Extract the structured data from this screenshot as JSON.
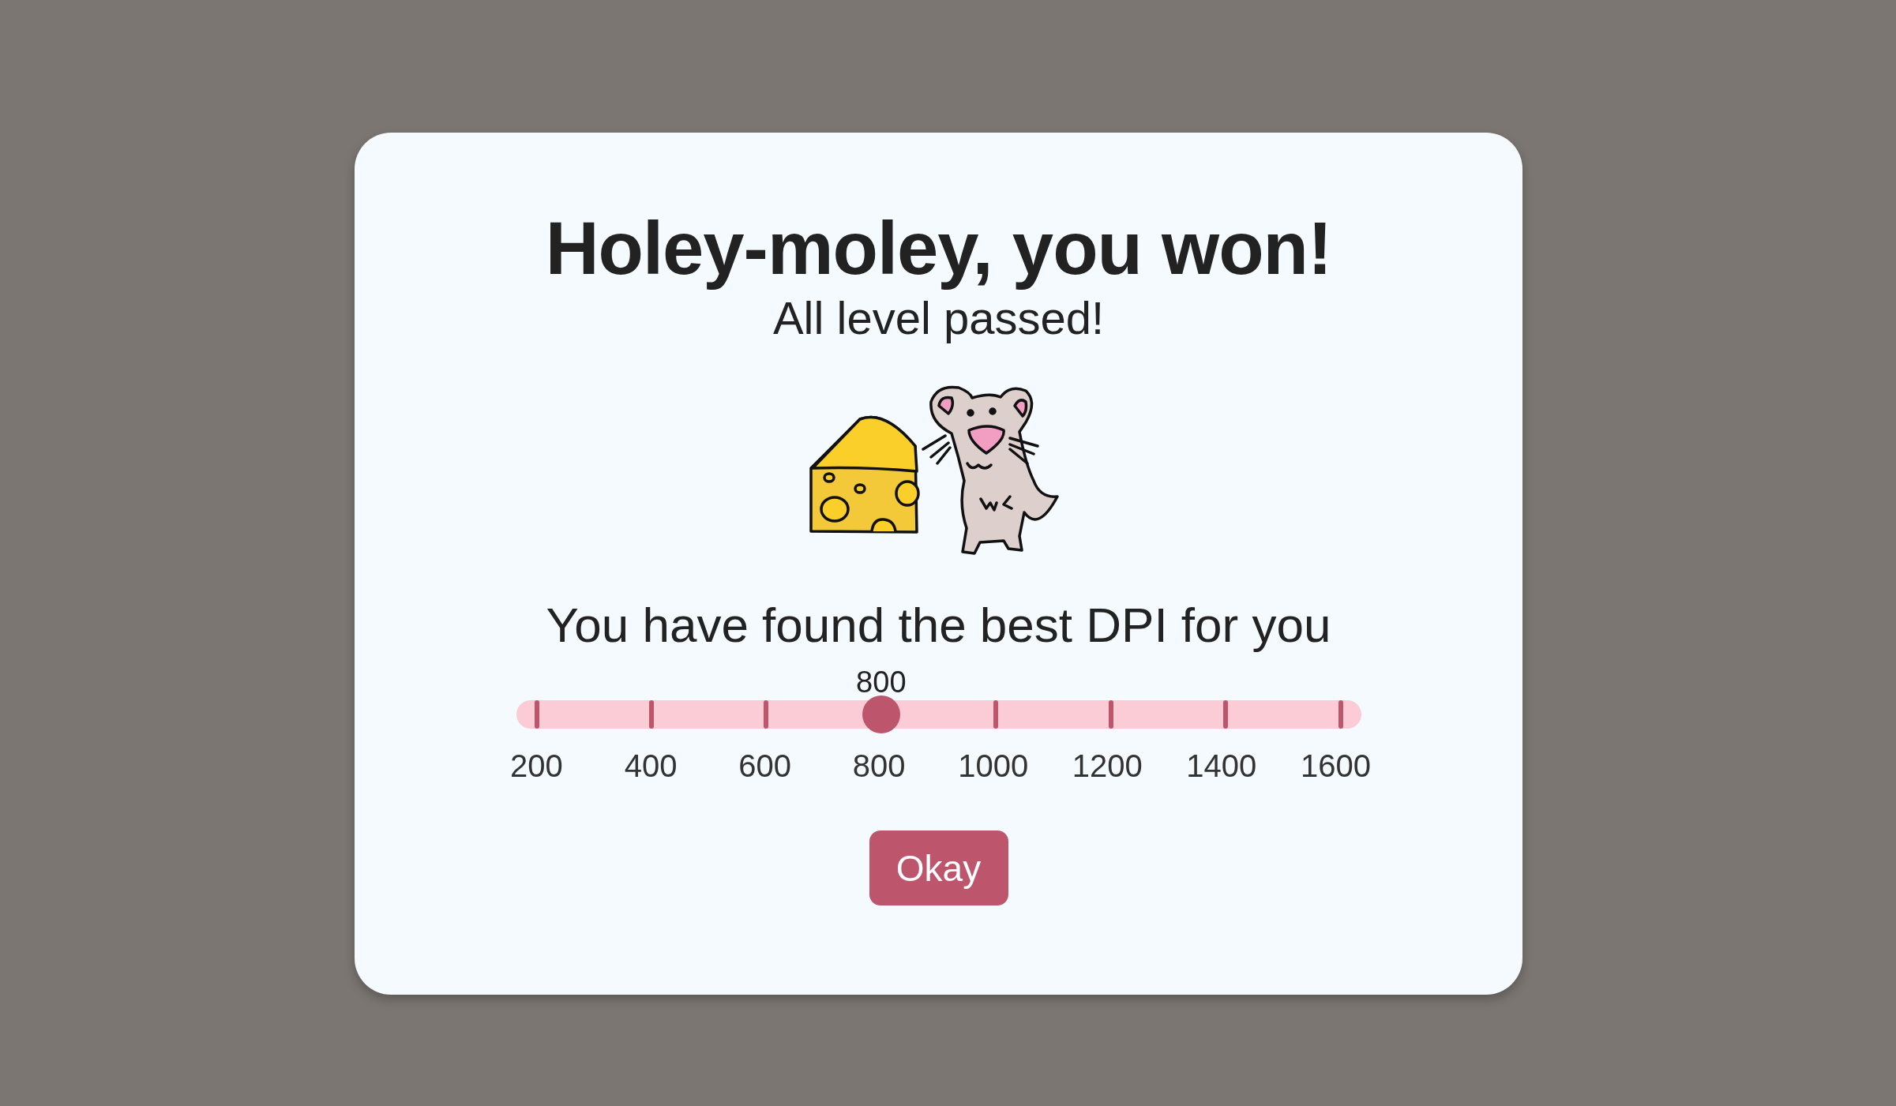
{
  "dialog": {
    "title": "Holey-moley, you won!",
    "subtitle": "All level passed!",
    "prompt": "You have found the best DPI for you",
    "slider": {
      "value_label": "800",
      "level": 0.4286,
      "ticks": [
        "200",
        "400",
        "600",
        "800",
        "1000",
        "1200",
        "1400",
        "1600"
      ]
    },
    "button": "Okay"
  }
}
